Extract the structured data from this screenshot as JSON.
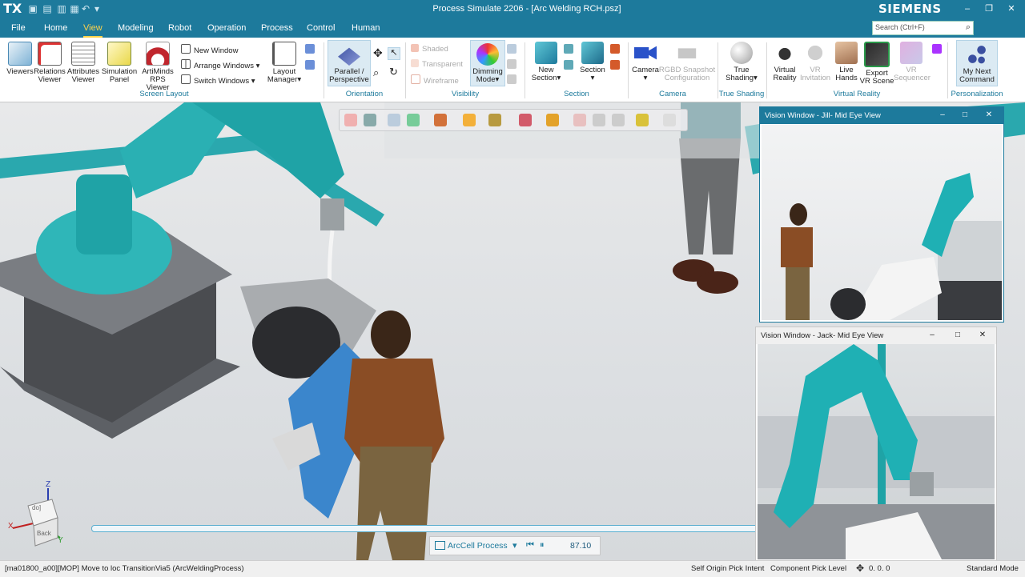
{
  "app": {
    "logo": "TX",
    "title": "Process Simulate 2206 - [Arc Welding RCH.psz]",
    "brand": "SIEMENS"
  },
  "menu": {
    "items": [
      "File",
      "Home",
      "View",
      "Modeling",
      "Robot",
      "Operation",
      "Process",
      "Control",
      "Human"
    ],
    "active": "View"
  },
  "search": {
    "placeholder": "Search (Ctrl+F)"
  },
  "ribbon": {
    "screen_layout": {
      "label": "Screen Layout",
      "viewers": "Viewers",
      "relations_viewer": [
        "Relations",
        "Viewer"
      ],
      "attributes_viewer": [
        "Attributes",
        "Viewer"
      ],
      "simulation_panel": [
        "Simulation",
        "Panel"
      ],
      "artiminds": [
        "ArtiMinds",
        "RPS Viewer"
      ],
      "new_window": "New Window",
      "arrange_windows": "Arrange Windows",
      "switch_windows": "Switch Windows",
      "layout_manager": [
        "Layout",
        "Manager"
      ]
    },
    "orientation": {
      "label": "Orientation",
      "parallel": [
        "Parallel /",
        "Perspective"
      ]
    },
    "visibility": {
      "label": "Visibility",
      "shaded": "Shaded",
      "transparent": "Transparent",
      "wireframe": "Wireframe",
      "dimming": [
        "Dimming",
        "Mode"
      ]
    },
    "section": {
      "label": "Section",
      "new_section": [
        "New",
        "Section"
      ],
      "section": "Section"
    },
    "camera": {
      "label": "Camera",
      "camera": "Camera",
      "rgbd": [
        "RGBD Snapshot",
        "Configuration"
      ]
    },
    "true_shading": {
      "label": "True Shading",
      "btn": [
        "True",
        "Shading"
      ]
    },
    "virtual_reality": {
      "label": "Virtual Reality",
      "vr": [
        "Virtual",
        "Reality"
      ],
      "vr_invitation": [
        "VR",
        "Invitation"
      ],
      "live_hands": [
        "Live",
        "Hands"
      ],
      "export_vr": [
        "Export",
        "VR Scene"
      ],
      "vr_sequencer": [
        "VR",
        "Sequencer"
      ]
    },
    "personalization": {
      "label": "Personalization",
      "my_next": [
        "My Next",
        "Command"
      ]
    }
  },
  "vision_windows": [
    {
      "title": "Vision Window - Jill- Mid Eye View",
      "bar_color": "#1d7a9c"
    },
    {
      "title": "Vision Window - Jack- Mid Eye View",
      "bar_color": "#f0f0f0"
    }
  ],
  "playback": {
    "process": "ArcCell Process",
    "time": "87.10"
  },
  "axis": {
    "z": "Z",
    "x": "X",
    "y": "Y",
    "top": "do]",
    "back": "Back"
  },
  "status": {
    "message": "[ma01800_a00][MOP] Move to loc TransitionVia5 (ArcWeldingProcess)",
    "pick_intent": "Self Origin Pick Intent",
    "pick_level": "Component Pick Level",
    "coords": "0. 0. 0",
    "mode": "Standard Mode"
  },
  "colors": {
    "accent": "#1d7a9c",
    "robot": "#1fb0b4",
    "highlight": "#ffd24a"
  }
}
